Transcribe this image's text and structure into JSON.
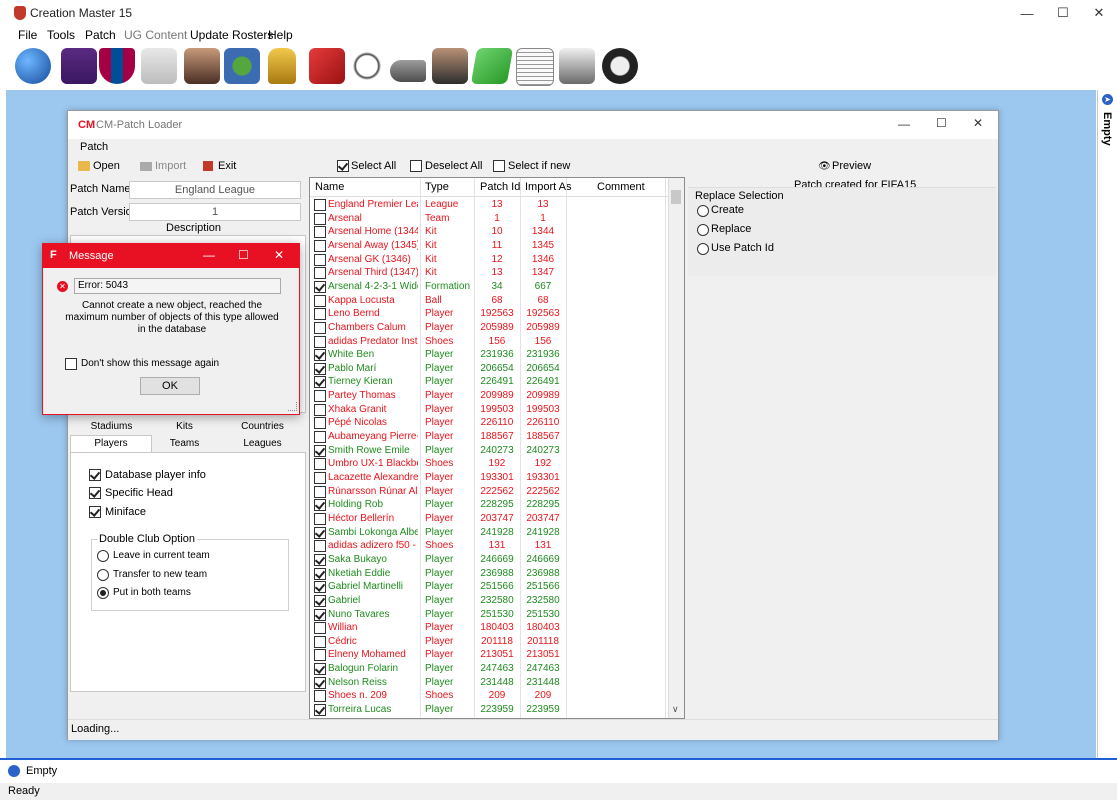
{
  "app": {
    "title": "Creation Master 15",
    "menu": [
      "File",
      "Tools",
      "Patch",
      "UG Content",
      "Update Rosters",
      "Help"
    ],
    "toolbar_icons": [
      "globe-icon",
      "premier-league-icon",
      "fc-barcelona-icon",
      "kit-icon",
      "player-icon",
      "stadium-icon",
      "trophy-icon",
      "card-icon",
      "ball-icon",
      "boot-icon",
      "manager-icon",
      "pitch-icon",
      "newspaper-icon",
      "gloves-icon",
      "headphones-icon"
    ],
    "right_panel_label": "Empty",
    "bottom_label": "Empty",
    "status": "Ready"
  },
  "loader": {
    "title": "CM-Patch Loader",
    "menu": "Patch",
    "buttons": {
      "open": "Open",
      "import": "Import",
      "exit": "Exit",
      "select_all": "Select All",
      "deselect_all": "Deselect All",
      "select_if_new": "Select if new",
      "preview": "Preview"
    },
    "patch_name_label": "Patch Name",
    "patch_name": "England League",
    "patch_version_label": "Patch Version",
    "patch_version": "1",
    "description_label": "Description",
    "tabs_row1": [
      "Stadiums",
      "Kits",
      "Countries"
    ],
    "tabs_row2": [
      "Players",
      "Teams",
      "Leagues"
    ],
    "options": [
      {
        "label": "Database player info",
        "checked": true
      },
      {
        "label": "Specific Head",
        "checked": true
      },
      {
        "label": "Miniface",
        "checked": true
      }
    ],
    "double_club": {
      "title": "Double Club Option",
      "choices": [
        "Leave in current team",
        "Transfer to new team",
        "Put in both teams"
      ],
      "selected": 2
    },
    "patch_created": "Patch created for FIFA15",
    "replace": {
      "title": "Replace Selection",
      "choices": [
        "Create",
        "Replace",
        "Use Patch Id"
      ]
    },
    "status": "Loading...",
    "columns": [
      "Name",
      "Type",
      "Patch Id",
      "Import As",
      "Comment"
    ],
    "rows": [
      {
        "name": "England Premier Lea...",
        "type": "League",
        "pid": "13",
        "imp": "13",
        "checked": false
      },
      {
        "name": "Arsenal",
        "type": "Team",
        "pid": "1",
        "imp": "1",
        "checked": false
      },
      {
        "name": "Arsenal Home (1344)",
        "type": "Kit",
        "pid": "10",
        "imp": "1344",
        "checked": false
      },
      {
        "name": "Arsenal Away (1345)",
        "type": "Kit",
        "pid": "11",
        "imp": "1345",
        "checked": false
      },
      {
        "name": "Arsenal GK (1346)",
        "type": "Kit",
        "pid": "12",
        "imp": "1346",
        "checked": false
      },
      {
        "name": "Arsenal Third (1347)",
        "type": "Kit",
        "pid": "13",
        "imp": "1347",
        "checked": false
      },
      {
        "name": "Arsenal 4-2-3-1 Wide",
        "type": "Formation",
        "pid": "34",
        "imp": "667",
        "checked": true
      },
      {
        "name": "Kappa Locusta",
        "type": "Ball",
        "pid": "68",
        "imp": "68",
        "checked": false
      },
      {
        "name": "Leno Bernd",
        "type": "Player",
        "pid": "192563",
        "imp": "192563",
        "checked": false
      },
      {
        "name": "Chambers Calum",
        "type": "Player",
        "pid": "205989",
        "imp": "205989",
        "checked": false
      },
      {
        "name": "adidas Predator Instin...",
        "type": "Shoes",
        "pid": "156",
        "imp": "156",
        "checked": false
      },
      {
        "name": "White Ben",
        "type": "Player",
        "pid": "231936",
        "imp": "231936",
        "checked": true
      },
      {
        "name": "Pablo Marí",
        "type": "Player",
        "pid": "206654",
        "imp": "206654",
        "checked": true
      },
      {
        "name": "Tierney Kieran",
        "type": "Player",
        "pid": "226491",
        "imp": "226491",
        "checked": true
      },
      {
        "name": "Partey Thomas",
        "type": "Player",
        "pid": "209989",
        "imp": "209989",
        "checked": false
      },
      {
        "name": "Xhaka Granit",
        "type": "Player",
        "pid": "199503",
        "imp": "199503",
        "checked": false
      },
      {
        "name": "Pépé Nicolas",
        "type": "Player",
        "pid": "226110",
        "imp": "226110",
        "checked": false
      },
      {
        "name": "Aubameyang Pierre-E...",
        "type": "Player",
        "pid": "188567",
        "imp": "188567",
        "checked": false
      },
      {
        "name": "Smith Rowe Emile",
        "type": "Player",
        "pid": "240273",
        "imp": "240273",
        "checked": true
      },
      {
        "name": "Umbro UX-1 Blackber...",
        "type": "Shoes",
        "pid": "192",
        "imp": "192",
        "checked": false
      },
      {
        "name": "Lacazette Alexandre",
        "type": "Player",
        "pid": "193301",
        "imp": "193301",
        "checked": false
      },
      {
        "name": "Rúnarsson Rúnar Alex",
        "type": "Player",
        "pid": "222562",
        "imp": "222562",
        "checked": false
      },
      {
        "name": "Holding Rob",
        "type": "Player",
        "pid": "228295",
        "imp": "228295",
        "checked": true
      },
      {
        "name": "Héctor Bellerín",
        "type": "Player",
        "pid": "203747",
        "imp": "203747",
        "checked": false
      },
      {
        "name": "Sambi Lokonga Albert",
        "type": "Player",
        "pid": "241928",
        "imp": "241928",
        "checked": true
      },
      {
        "name": "adidas adizero f50 - ...",
        "type": "Shoes",
        "pid": "131",
        "imp": "131",
        "checked": false
      },
      {
        "name": "Saka Bukayo",
        "type": "Player",
        "pid": "246669",
        "imp": "246669",
        "checked": true
      },
      {
        "name": "Nketiah Eddie",
        "type": "Player",
        "pid": "236988",
        "imp": "236988",
        "checked": true
      },
      {
        "name": "Gabriel Martinelli",
        "type": "Player",
        "pid": "251566",
        "imp": "251566",
        "checked": true
      },
      {
        "name": "Gabriel",
        "type": "Player",
        "pid": "232580",
        "imp": "232580",
        "checked": true
      },
      {
        "name": "Nuno Tavares",
        "type": "Player",
        "pid": "251530",
        "imp": "251530",
        "checked": true
      },
      {
        "name": "Willian",
        "type": "Player",
        "pid": "180403",
        "imp": "180403",
        "checked": false
      },
      {
        "name": "Cédric",
        "type": "Player",
        "pid": "201118",
        "imp": "201118",
        "checked": false
      },
      {
        "name": "Elneny Mohamed",
        "type": "Player",
        "pid": "213051",
        "imp": "213051",
        "checked": false
      },
      {
        "name": "Balogun Folarin",
        "type": "Player",
        "pid": "247463",
        "imp": "247463",
        "checked": true
      },
      {
        "name": "Nelson Reiss",
        "type": "Player",
        "pid": "231448",
        "imp": "231448",
        "checked": true
      },
      {
        "name": "Shoes n. 209",
        "type": "Shoes",
        "pid": "209",
        "imp": "209",
        "checked": false
      },
      {
        "name": "Torreira Lucas",
        "type": "Player",
        "pid": "223959",
        "imp": "223959",
        "checked": true
      }
    ]
  },
  "dialog": {
    "title": "Message",
    "error": "Error: 5043",
    "message": "Cannot create a new object, reached the maximum number of objects of this type allowed in the database",
    "dont_show": "Don't show this message again",
    "ok": "OK"
  },
  "colors": {
    "workspace": "#9cc8f0",
    "new_item": "#1f8c1f",
    "existing_item": "#e8141c",
    "dialog_accent": "#e81123"
  }
}
